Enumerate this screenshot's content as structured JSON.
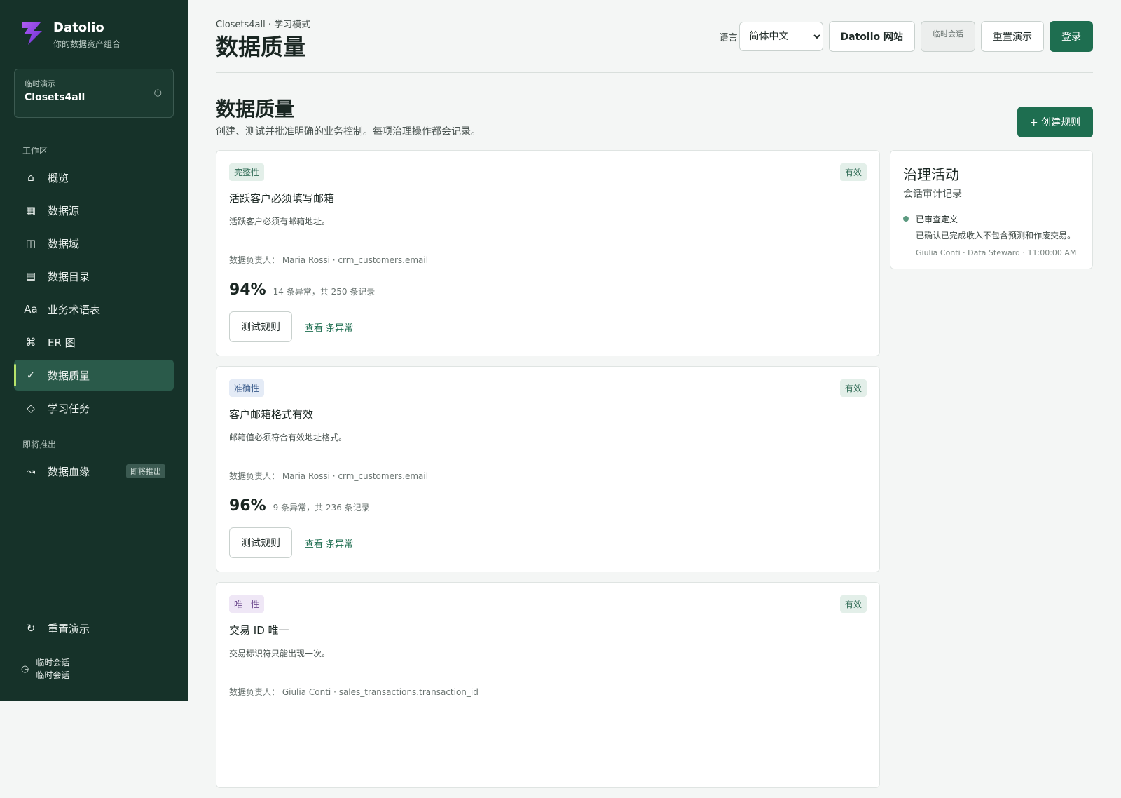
{
  "brand": {
    "name": "Datolio",
    "tagline": "你的数据资产组合"
  },
  "demo": {
    "label": "临时演示",
    "value": "Closets4all"
  },
  "sidebar": {
    "workspace_label": "工作区",
    "items": [
      {
        "label": "概览",
        "icon": "⌂"
      },
      {
        "label": "数据源",
        "icon": "▦"
      },
      {
        "label": "数据域",
        "icon": "◫"
      },
      {
        "label": "数据目录",
        "icon": "▤"
      },
      {
        "label": "业务术语表",
        "icon": "Aa"
      },
      {
        "label": "ER 图",
        "icon": "⌘"
      },
      {
        "label": "数据质量",
        "icon": "✓"
      },
      {
        "label": "学习任务",
        "icon": "◇"
      }
    ],
    "coming_label": "即将推出",
    "coming_items": [
      {
        "label": "数据血缘",
        "icon": "↝",
        "badge": "即将推出"
      }
    ],
    "reset_label": "重置演示",
    "reset_icon": "↻",
    "session_line1": "临时会话",
    "session_line2": "临时会话"
  },
  "header": {
    "crumb": "Closets4all · 学习模式",
    "title": "数据质量",
    "lang_label": "语言",
    "lang_value": "简体中文",
    "site_button": "Datolio 网站",
    "session_button": "临时会话",
    "reset_button": "重置演示",
    "login_button": "登录"
  },
  "section": {
    "title": "数据质量",
    "subtitle": "创建、测试并批准明确的业务控制。每项治理操作都会记录。",
    "create_button": "+ 创建规则"
  },
  "rules": [
    {
      "tag": "完整性",
      "tag_color": "green",
      "status": "有效",
      "title": "活跃客户必须填写邮箱",
      "desc": "活跃客户必须有邮箱地址。",
      "owner": "数据负责人： Maria Rossi · crm_customers.email",
      "pct": "94%",
      "note": "14 条异常，共 250 条记录",
      "test_button": "测试规则",
      "view_link": "查看 条异常"
    },
    {
      "tag": "准确性",
      "tag_color": "blue",
      "status": "有效",
      "title": "客户邮箱格式有效",
      "desc": "邮箱值必须符合有效地址格式。",
      "owner": "数据负责人： Maria Rossi · crm_customers.email",
      "pct": "96%",
      "note": "9 条异常，共 236 条记录",
      "test_button": "测试规则",
      "view_link": "查看 条异常"
    },
    {
      "tag": "唯一性",
      "tag_color": "purple",
      "status": "有效",
      "title": "交易 ID 唯一",
      "desc": "交易标识符只能出现一次。",
      "owner": "数据负责人： Giulia Conti · sales_transactions.transaction_id"
    }
  ],
  "activity": {
    "title": "治理活动",
    "subtitle": "会话审计记录",
    "entry_title": "已审查定义",
    "entry_desc": "已确认已完成收入不包含预测和作废交易。",
    "entry_meta": "Giulia Conti · Data Steward · 11:00:00 AM"
  }
}
